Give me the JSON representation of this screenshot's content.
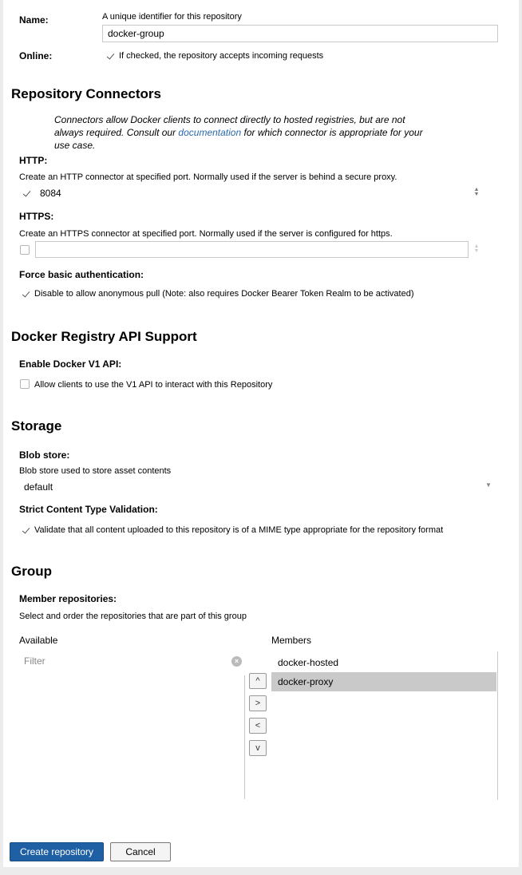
{
  "colors": {
    "primary_button": "#1f5fa4",
    "link": "#2a6aad",
    "selected_row": "#c9c9c9"
  },
  "name_field": {
    "label": "Name:",
    "help": "A unique identifier for this repository",
    "value": "docker-group"
  },
  "online_field": {
    "label": "Online:",
    "checked": true,
    "text": "If checked, the repository accepts incoming requests"
  },
  "connectors": {
    "title": "Repository Connectors",
    "desc_line1": "Connectors allow Docker clients to connect directly to hosted registries, but are not",
    "desc_line2_pre": "always required. Consult our ",
    "desc_link": "documentation",
    "desc_line2_post": " for which connector is appropriate for your",
    "desc_line3": "use case.",
    "http": {
      "label": "HTTP:",
      "help": "Create an HTTP connector at specified port. Normally used if the server is behind a secure proxy.",
      "checked": true,
      "value": "8084"
    },
    "https": {
      "label": "HTTPS:",
      "help": "Create an HTTPS connector at specified port. Normally used if the server is configured for https.",
      "checked": false,
      "value": ""
    },
    "force_auth": {
      "label": "Force basic authentication:",
      "checked": true,
      "text": "Disable to allow anonymous pull (Note: also requires Docker Bearer Token Realm to be activated)"
    }
  },
  "api_support": {
    "title": "Docker Registry API Support",
    "v1_label": "Enable Docker V1 API:",
    "v1_checked": false,
    "v1_text": "Allow clients to use the V1 API to interact with this Repository"
  },
  "storage": {
    "title": "Storage",
    "blob_label": "Blob store:",
    "blob_help": "Blob store used to store asset contents",
    "blob_value": "default",
    "strict_label": "Strict Content Type Validation:",
    "strict_checked": true,
    "strict_text": "Validate that all content uploaded to this repository is of a MIME type appropriate for the repository format"
  },
  "group": {
    "title": "Group",
    "members_label": "Member repositories:",
    "members_help": "Select and order the repositories that are part of this group",
    "available_header": "Available",
    "members_header": "Members",
    "filter_placeholder": "Filter",
    "members": [
      "docker-hosted",
      "docker-proxy"
    ],
    "selected_member": "docker-proxy",
    "move_buttons": [
      "^",
      ">",
      "<",
      "v"
    ]
  },
  "actions": {
    "create_label": "Create repository",
    "cancel_label": "Cancel"
  }
}
